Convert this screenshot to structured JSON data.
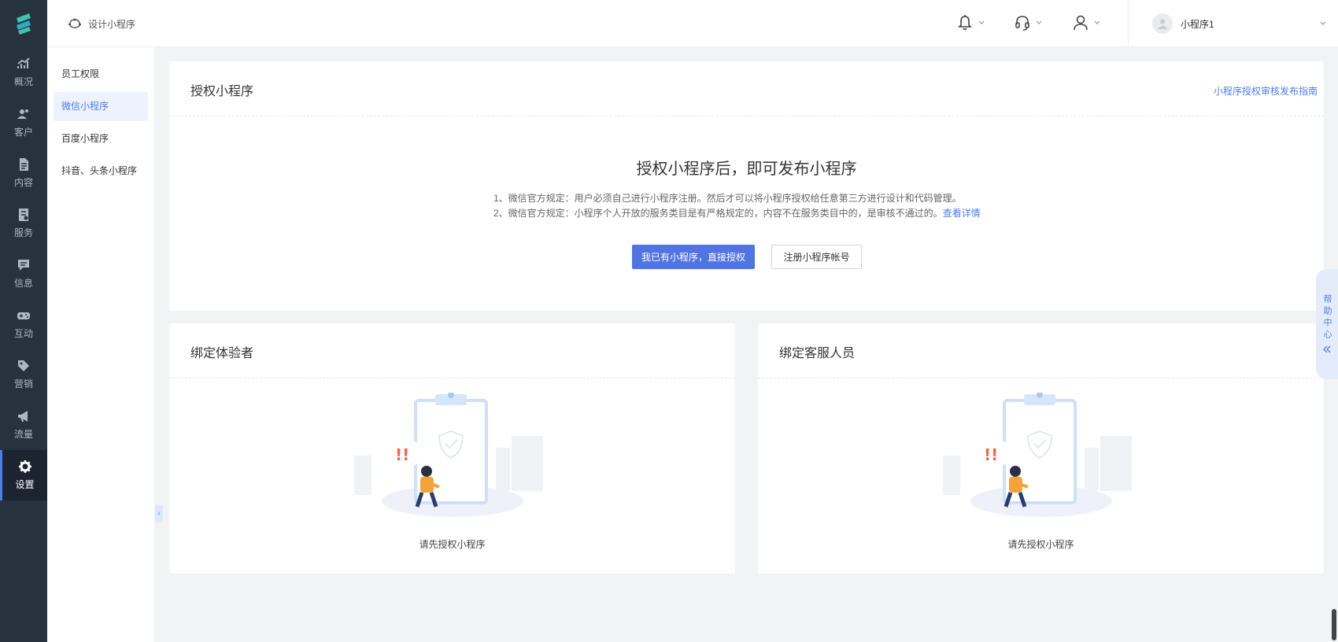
{
  "rail": {
    "items": [
      {
        "label": "概况",
        "icon": "chart-icon"
      },
      {
        "label": "客户",
        "icon": "users-icon"
      },
      {
        "label": "内容",
        "icon": "document-icon"
      },
      {
        "label": "服务",
        "icon": "service-icon"
      },
      {
        "label": "信息",
        "icon": "message-icon"
      },
      {
        "label": "互动",
        "icon": "gamepad-icon"
      },
      {
        "label": "营销",
        "icon": "tag-icon"
      },
      {
        "label": "流量",
        "icon": "megaphone-icon"
      },
      {
        "label": "设置",
        "icon": "gear-icon"
      }
    ]
  },
  "subnav": {
    "items": [
      {
        "label": "员工权限"
      },
      {
        "label": "微信小程序"
      },
      {
        "label": "百度小程序"
      },
      {
        "label": "抖音、头条小程序"
      }
    ]
  },
  "topbar": {
    "breadcrumb": "设计小程序",
    "user_name": "小程序1"
  },
  "auth_card": {
    "title": "授权小程序",
    "guide_link": "小程序授权审核发布指南",
    "heading": "授权小程序后，即可发布小程序",
    "rule1": "1、微信官方规定：用户必须自己进行小程序注册。然后才可以将小程序授权给任意第三方进行设计和代码管理。",
    "rule2": "2、微信官方规定：小程序个人开放的服务类目是有严格规定的，内容不在服务类目中的，是审核不通过的。",
    "rule2_link": "查看详情",
    "primary_button": "我已有小程序，直接授权",
    "secondary_button": "注册小程序帐号"
  },
  "tester_card": {
    "title": "绑定体验者",
    "empty_text": "请先授权小程序"
  },
  "service_card": {
    "title": "绑定客服人员",
    "empty_text": "请先授权小程序"
  },
  "help_tab": {
    "label": "帮助中心"
  },
  "colors": {
    "rail_bg": "#27323f",
    "accent": "#4f7de6",
    "primary_button": "#5174e0"
  }
}
